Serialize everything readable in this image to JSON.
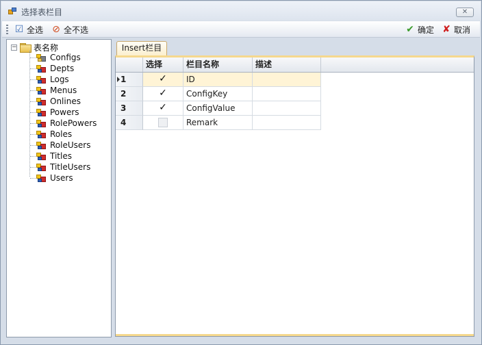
{
  "window": {
    "title": "选择表栏目",
    "close_symbol": "✕"
  },
  "toolbar": {
    "select_all_label": "全选",
    "select_none_label": "全不选",
    "ok_label": "确定",
    "cancel_label": "取消"
  },
  "tree": {
    "root_label": "表名称",
    "root_expander": "−",
    "items": [
      {
        "label": "Configs",
        "icon": "config-table-icon"
      },
      {
        "label": "Depts",
        "icon": "table-icon"
      },
      {
        "label": "Logs",
        "icon": "table-icon"
      },
      {
        "label": "Menus",
        "icon": "table-icon"
      },
      {
        "label": "Onlines",
        "icon": "table-icon"
      },
      {
        "label": "Powers",
        "icon": "table-icon"
      },
      {
        "label": "RolePowers",
        "icon": "table-icon"
      },
      {
        "label": "Roles",
        "icon": "table-icon"
      },
      {
        "label": "RoleUsers",
        "icon": "table-icon"
      },
      {
        "label": "Titles",
        "icon": "table-icon"
      },
      {
        "label": "TitleUsers",
        "icon": "table-icon"
      },
      {
        "label": "Users",
        "icon": "table-icon"
      }
    ]
  },
  "tab": {
    "label": "Insert栏目"
  },
  "grid": {
    "columns": [
      "选择",
      "栏目名称",
      "描述"
    ],
    "rows": [
      {
        "index": "1",
        "checked": true,
        "name": "ID",
        "description": "",
        "current": true
      },
      {
        "index": "2",
        "checked": true,
        "name": "ConfigKey",
        "description": "",
        "current": false
      },
      {
        "index": "3",
        "checked": true,
        "name": "ConfigValue",
        "description": "",
        "current": false
      },
      {
        "index": "4",
        "checked": false,
        "name": "Remark",
        "description": "",
        "current": false
      }
    ]
  },
  "colors": {
    "tab_accent": "#f5d88d",
    "selected_row": "#fff4d6",
    "ok_icon": "#3a9a2b",
    "cancel_icon": "#cf1f1f"
  }
}
